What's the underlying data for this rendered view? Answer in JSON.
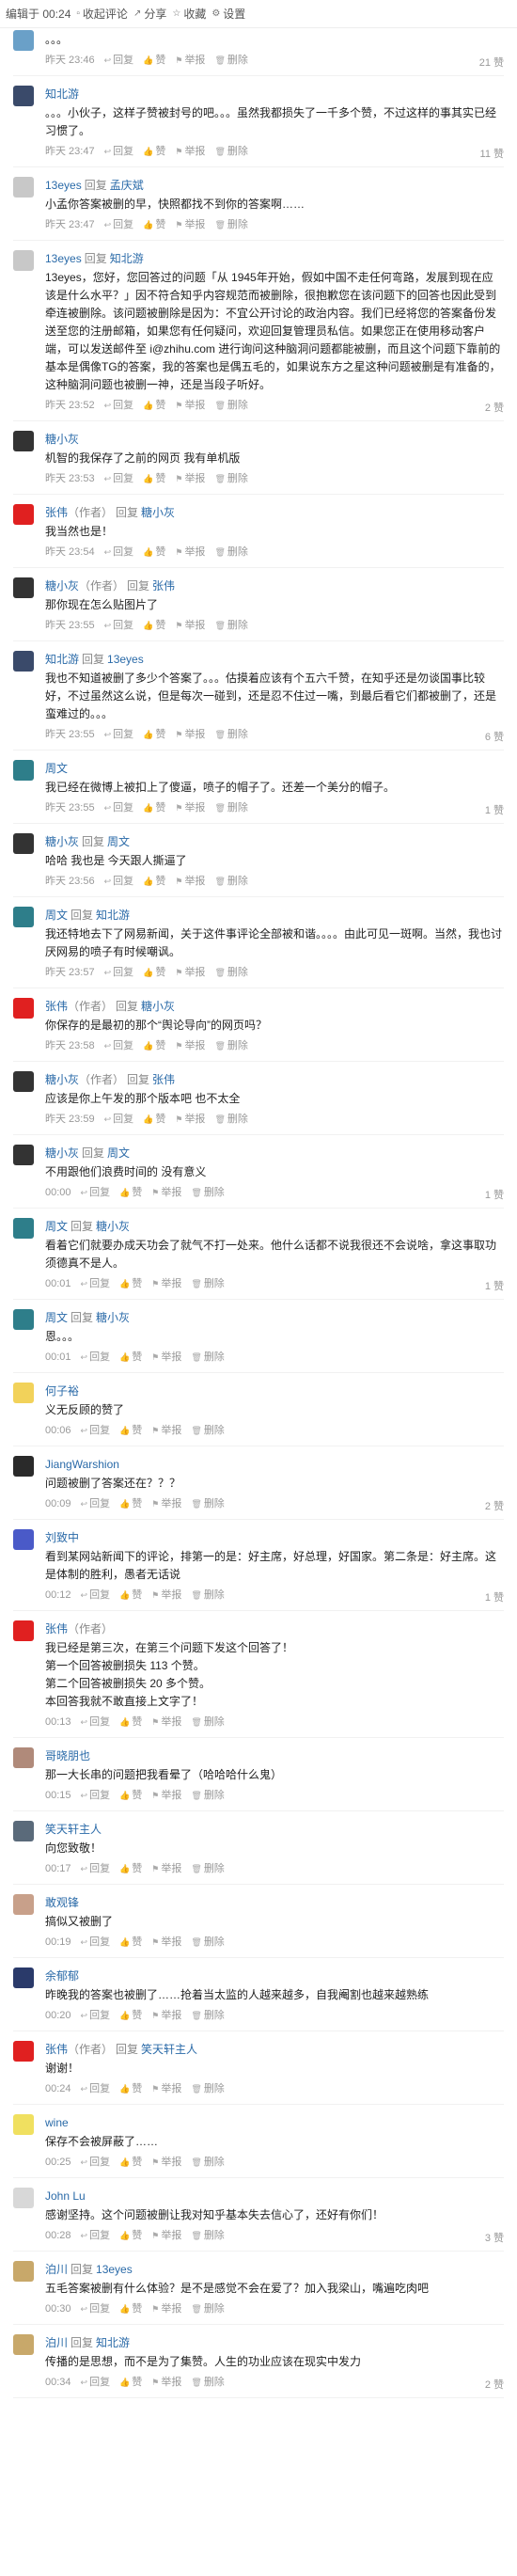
{
  "topbar": {
    "edited": "编辑于 00:24",
    "collapse": "收起评论",
    "share": "分享",
    "collect": "收藏",
    "settings": "设置"
  },
  "actions": {
    "reply": "回复",
    "like": "赞",
    "report": "举报",
    "delete": "删除"
  },
  "comments": [
    {
      "author": "",
      "reply_to": "",
      "role": "",
      "text": "。。。",
      "time": "昨天 23:46",
      "likes": "21 赞",
      "avatar": "#6aa0c8"
    },
    {
      "author": "知北游",
      "reply_to": "",
      "role": "",
      "text": "。。。小伙子，这样子赞被封号的吧。。。虽然我都损失了一千多个赞，不过这样的事其实已经习惯了。",
      "time": "昨天 23:47",
      "likes": "11 赞",
      "avatar": "#3a4a6a"
    },
    {
      "author": "13eyes",
      "reply_to": "孟庆斌",
      "role": "",
      "text": "小孟你答案被删的早，快照都找不到你的答案啊……",
      "time": "昨天 23:47",
      "likes": "",
      "avatar": "#c8c8c8"
    },
    {
      "author": "13eyes",
      "reply_to": "知北游",
      "role": "",
      "text": "13eyes，您好，您回答过的问题「从 1945年开始，假如中国不走任何弯路，发展到现在应该是什么水平？」因不符合知乎内容规范而被删除，很抱歉您在该问题下的回答也因此受到牵连被删除。该问题被删除是因为：不宜公开讨论的政治内容。我们已经将您的答案备份发送至您的注册邮箱，如果您有任何疑问，欢迎回复管理员私信。如果您正在使用移动客户端，可以发送邮件至 i@zhihu.com 进行询问这种脑洞问题都能被删，而且这个问题下靠前的基本是偶像TG的答案，我的答案也是偶五毛的，如果说东方之星这种问题被删是有准备的，这种脑洞问题也被删一神，还是当段子听好。",
      "time": "昨天 23:52",
      "likes": "2 赞",
      "avatar": "#c8c8c8"
    },
    {
      "author": "糖小灰",
      "reply_to": "",
      "role": "",
      "text": "机智的我保存了之前的网页 我有单机版",
      "time": "昨天 23:53",
      "likes": "",
      "avatar": "#333333"
    },
    {
      "author": "张伟",
      "reply_to": "糖小灰",
      "role": "（作者）",
      "text": "我当然也是！",
      "time": "昨天 23:54",
      "likes": "",
      "avatar": "#e02020"
    },
    {
      "author": "糖小灰",
      "reply_to": "张伟",
      "role": "（作者）",
      "text": "那你现在怎么贴图片了",
      "time": "昨天 23:55",
      "likes": "",
      "avatar": "#333333"
    },
    {
      "author": "知北游",
      "reply_to": "13eyes",
      "role": "",
      "text": "我也不知道被删了多少个答案了。。。估摸着应该有个五六千赞，在知乎还是勿谈国事比较好，不过虽然这么说，但是每次一碰到，还是忍不住过一嘴，到最后看它们都被删了，还是蛮难过的。。。",
      "time": "昨天 23:55",
      "likes": "6 赞",
      "avatar": "#3a4a6a"
    },
    {
      "author": "周文",
      "reply_to": "",
      "role": "",
      "text": "我已经在微博上被扣上了傻逼，喷子的帽子了。还差一个美分的帽子。",
      "time": "昨天 23:55",
      "likes": "1 赞",
      "avatar": "#2e7e8a"
    },
    {
      "author": "糖小灰",
      "reply_to": "周文",
      "role": "",
      "text": "哈哈 我也是 今天跟人撕逼了",
      "time": "昨天 23:56",
      "likes": "",
      "avatar": "#333333"
    },
    {
      "author": "周文",
      "reply_to": "知北游",
      "role": "",
      "text": "我还特地去下了网易新闻，关于这件事评论全部被和谐。。。。由此可见一斑啊。当然，我也讨厌网易的喷子有时候嘲讽。",
      "time": "昨天 23:57",
      "likes": "",
      "avatar": "#2e7e8a"
    },
    {
      "author": "张伟",
      "reply_to": "糖小灰",
      "role": "（作者）",
      "text": "你保存的是最初的那个“舆论导向”的网页吗？",
      "time": "昨天 23:58",
      "likes": "",
      "avatar": "#e02020"
    },
    {
      "author": "糖小灰",
      "reply_to": "张伟",
      "role": "（作者）",
      "text": "应该是你上午发的那个版本吧 也不太全",
      "time": "昨天 23:59",
      "likes": "",
      "avatar": "#333333"
    },
    {
      "author": "糖小灰",
      "reply_to": "周文",
      "role": "",
      "text": "不用跟他们浪费时间的 没有意义",
      "time": "00:00",
      "likes": "1 赞",
      "avatar": "#333333"
    },
    {
      "author": "周文",
      "reply_to": "糖小灰",
      "role": "",
      "text": "看着它们就要办成天功会了就气不打一处来。他什么话都不说我很还不会说啥，拿这事取功须德真不是人。",
      "time": "00:01",
      "likes": "1 赞",
      "avatar": "#2e7e8a"
    },
    {
      "author": "周文",
      "reply_to": "糖小灰",
      "role": "",
      "text": "恩。。。",
      "time": "00:01",
      "likes": "",
      "avatar": "#2e7e8a"
    },
    {
      "author": "何子裕",
      "reply_to": "",
      "role": "",
      "text": "义无反顾的赞了",
      "time": "00:06",
      "likes": "",
      "avatar": "#f2d25a"
    },
    {
      "author": "JiangWarshion",
      "reply_to": "",
      "role": "",
      "text": "问题被删了答案还在？？？",
      "time": "00:09",
      "likes": "2 赞",
      "avatar": "#2a2a2a"
    },
    {
      "author": "刘致中",
      "reply_to": "",
      "role": "",
      "text": "看到某网站新闻下的评论，排第一的是：好主席，好总理，好国家。第二条是：好主席。这是体制的胜利，愚者无话说",
      "time": "00:12",
      "likes": "1 赞",
      "avatar": "#4a5ac8"
    },
    {
      "author": "张伟",
      "reply_to": "",
      "role": "（作者）",
      "text": "我已经是第三次，在第三个问题下发这个回答了！\n第一个回答被删损失 113 个赞。\n第二个回答被删损失 20 多个赞。\n本回答我就不敢直接上文字了！",
      "time": "00:13",
      "likes": "",
      "avatar": "#e02020"
    },
    {
      "author": "哥晓朋也",
      "reply_to": "",
      "role": "",
      "text": "那一大长串的问题把我看晕了（哈哈哈什么鬼）",
      "time": "00:15",
      "likes": "",
      "avatar": "#b08a7a"
    },
    {
      "author": "笑天轩主人",
      "reply_to": "",
      "role": "",
      "text": "向您致敬！",
      "time": "00:17",
      "likes": "",
      "avatar": "#5a6a7a"
    },
    {
      "author": "敢观锋",
      "reply_to": "",
      "role": "",
      "text": "搞似又被删了",
      "time": "00:19",
      "likes": "",
      "avatar": "#c8a08a"
    },
    {
      "author": "余郁郁",
      "reply_to": "",
      "role": "",
      "text": "昨晚我的答案也被删了……抢着当太监的人越来越多，自我阉割也越来越熟练",
      "time": "00:20",
      "likes": "",
      "avatar": "#2a3a6a"
    },
    {
      "author": "张伟",
      "reply_to": "笑天轩主人",
      "role": "（作者）",
      "text": "谢谢！",
      "time": "00:24",
      "likes": "",
      "avatar": "#e02020"
    },
    {
      "author": "wine",
      "reply_to": "",
      "role": "",
      "text": "保存不会被屏蔽了……",
      "time": "00:25",
      "likes": "",
      "avatar": "#f0e060"
    },
    {
      "author": "John Lu",
      "reply_to": "",
      "role": "",
      "text": "感谢坚持。这个问题被删让我对知乎基本失去信心了，还好有你们！",
      "time": "00:28",
      "likes": "3 赞",
      "avatar": "#d8d8d8"
    },
    {
      "author": "泊川",
      "reply_to": "13eyes",
      "role": "",
      "text": "五毛答案被删有什么体验？是不是感觉不会在爱了？加入我梁山，嘴遍吃肉吧",
      "time": "00:30",
      "likes": "",
      "avatar": "#c8a86a"
    },
    {
      "author": "泊川",
      "reply_to": "知北游",
      "role": "",
      "text": "传播的是思想，而不是为了集赞。人生的功业应该在现实中发力",
      "time": "00:34",
      "likes": "2 赞",
      "avatar": "#c8a86a"
    }
  ]
}
